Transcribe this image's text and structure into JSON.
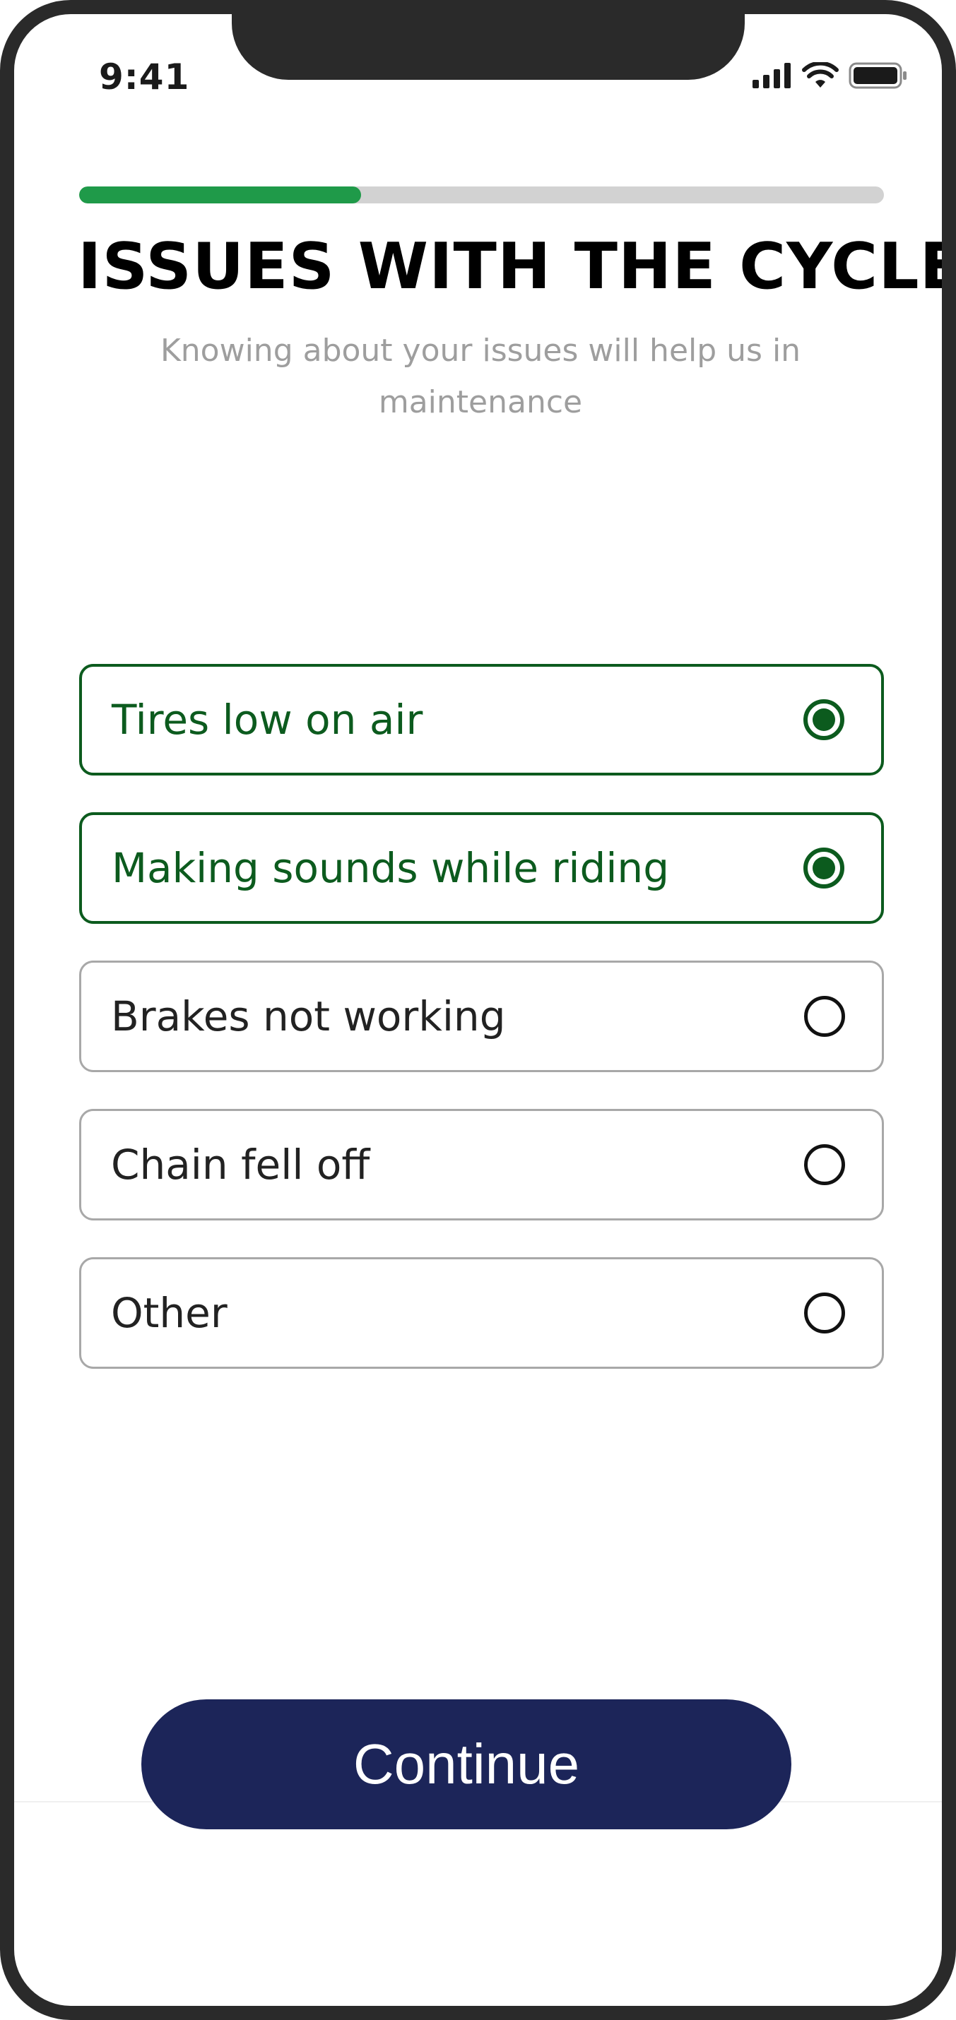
{
  "status_bar": {
    "time": "9:41",
    "icons": [
      "cellular-signal-icon",
      "wifi-icon",
      "battery-icon"
    ]
  },
  "progress": {
    "value": 0.35,
    "fill_color": "#1f9a49",
    "track_color": "#d2d2d2"
  },
  "header": {
    "title": "ISSUES WITH THE CYCLE",
    "subtitle": "Knowing about your issues will help us in maintenance"
  },
  "options": [
    {
      "label": "Tires low on air",
      "selected": true
    },
    {
      "label": "Making sounds while riding",
      "selected": true
    },
    {
      "label": "Brakes not working",
      "selected": false
    },
    {
      "label": "Chain fell off",
      "selected": false
    },
    {
      "label": "Other",
      "selected": false
    }
  ],
  "continue_button": {
    "label": "Continue"
  },
  "colors": {
    "selected_accent": "#0c5b1e",
    "button_background": "#1c2559",
    "phone_frame": "#2a2a2a"
  }
}
